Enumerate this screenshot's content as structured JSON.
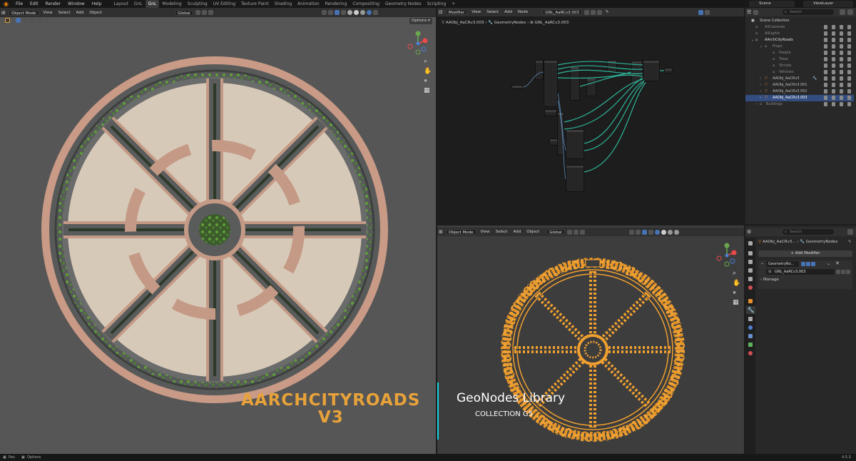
{
  "menu": {
    "items": [
      "File",
      "Edit",
      "Render",
      "Window",
      "Help"
    ],
    "workspaces": [
      "Layout",
      "GnL",
      "GnL",
      "Modeling",
      "Sculpting",
      "UV Editing",
      "Texture Paint",
      "Shading",
      "Animation",
      "Rendering",
      "Compositing",
      "Geometry Nodes",
      "Scripting"
    ],
    "active_workspace_index": 2,
    "add_tab": "+",
    "scene_label": "Scene",
    "view_layer_label": "ViewLayer"
  },
  "viewport_left": {
    "mode": "Object Mode",
    "menus": [
      "View",
      "Select",
      "Add",
      "Object"
    ],
    "orientation": "Global",
    "options_label": "Options",
    "overlay_title_line1": "AARCHCITYROADS",
    "overlay_title_line2": "V3",
    "overlay_color": "#e8a23a",
    "ground_color": "#565656"
  },
  "node_editor": {
    "editor_type": "Modifier",
    "menus": [
      "View",
      "Select",
      "Add",
      "Node"
    ],
    "node_group": "GNL_AaRCv3.003",
    "breadcrumb": [
      "AAObj_AaCRv3.003",
      "GeometryNodes",
      "GNL_AaRCv3.003"
    ],
    "link_color": "#2fc6a7"
  },
  "outliner": {
    "search_placeholder": "Search",
    "rows": [
      {
        "label": "Scene Collection",
        "selected": false
      },
      {
        "label": "AllCameras",
        "selected": false
      },
      {
        "label": "AllLights",
        "selected": false
      },
      {
        "label": "AArchCityRoads",
        "selected": false
      },
      {
        "label": "Props",
        "selected": false
      },
      {
        "label": "People",
        "selected": false
      },
      {
        "label": "Trees",
        "selected": false
      },
      {
        "label": "Shrubs",
        "selected": false
      },
      {
        "label": "Vehicles",
        "selected": false
      },
      {
        "label": "AAObj_AaCRv3",
        "selected": false
      },
      {
        "label": "AAObj_AaCRv3.001",
        "selected": false
      },
      {
        "label": "AAObj_AaCRv3.002",
        "selected": false
      },
      {
        "label": "AAObj_AaCRv3.003",
        "selected": true
      },
      {
        "label": "Buildings",
        "selected": false
      }
    ]
  },
  "viewport_right": {
    "mode": "Object Mode",
    "menus": [
      "View",
      "Select",
      "Add",
      "Object"
    ],
    "orientation": "Global",
    "wireframe_color": "#f0a030",
    "banner_title": "GeoNodes Library",
    "banner_subtitle": "COLLECTION G5",
    "accent_bar_color": "#19d3e0"
  },
  "properties": {
    "search_placeholder": "Search",
    "breadcrumb": [
      "AAObj_AaCRv3...",
      "GeometryNodes"
    ],
    "add_modifier": "+ Add Modifier",
    "modifier_name": "GeometryNo...",
    "node_group": "GNL_AaRCv3.003",
    "manage_label": "Manage"
  },
  "statusbar": {
    "left_items": [
      "Pan",
      "Options"
    ],
    "version": "4.5.3"
  }
}
